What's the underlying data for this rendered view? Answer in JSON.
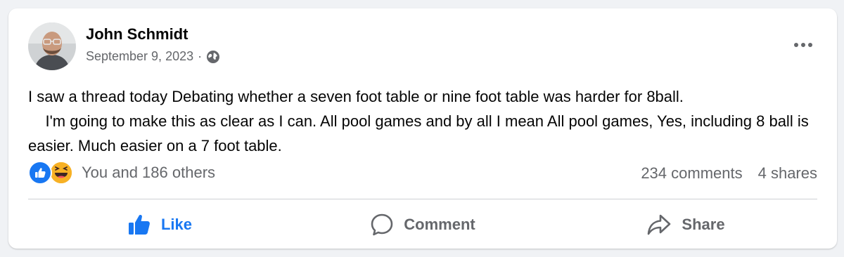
{
  "post": {
    "author": "John Schmidt",
    "date": "September 9, 2023",
    "separator": "·",
    "privacy_icon": "globe-icon",
    "body": "I saw a thread today Debating whether a seven foot table or nine foot table was harder for 8ball.\n    I'm going to make this as clear as I can. All pool games and by all I mean All pool games, Yes, including 8 ball is easier. Much easier on a 7 foot table."
  },
  "engagement": {
    "reactions_text": "You and 186 others",
    "reaction_icons": [
      "like-reaction-icon",
      "haha-reaction-icon"
    ],
    "comments": "234 comments",
    "shares": "4 shares"
  },
  "actions": {
    "like_label": "Like",
    "comment_label": "Comment",
    "share_label": "Share"
  },
  "colors": {
    "accent": "#1877f2",
    "secondary_text": "#65676b",
    "primary_text": "#050505",
    "haha_yellow": "#f7b125",
    "background": "#f0f2f5"
  }
}
